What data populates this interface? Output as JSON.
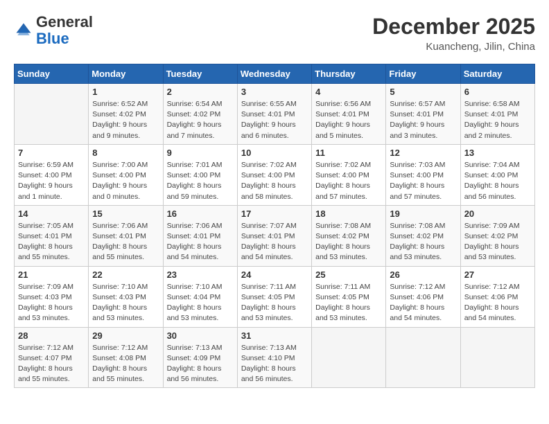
{
  "header": {
    "logo_general": "General",
    "logo_blue": "Blue",
    "month_year": "December 2025",
    "location": "Kuancheng, Jilin, China"
  },
  "weekdays": [
    "Sunday",
    "Monday",
    "Tuesday",
    "Wednesday",
    "Thursday",
    "Friday",
    "Saturday"
  ],
  "weeks": [
    [
      {
        "day": "",
        "detail": ""
      },
      {
        "day": "1",
        "detail": "Sunrise: 6:52 AM\nSunset: 4:02 PM\nDaylight: 9 hours\nand 9 minutes."
      },
      {
        "day": "2",
        "detail": "Sunrise: 6:54 AM\nSunset: 4:02 PM\nDaylight: 9 hours\nand 7 minutes."
      },
      {
        "day": "3",
        "detail": "Sunrise: 6:55 AM\nSunset: 4:01 PM\nDaylight: 9 hours\nand 6 minutes."
      },
      {
        "day": "4",
        "detail": "Sunrise: 6:56 AM\nSunset: 4:01 PM\nDaylight: 9 hours\nand 5 minutes."
      },
      {
        "day": "5",
        "detail": "Sunrise: 6:57 AM\nSunset: 4:01 PM\nDaylight: 9 hours\nand 3 minutes."
      },
      {
        "day": "6",
        "detail": "Sunrise: 6:58 AM\nSunset: 4:01 PM\nDaylight: 9 hours\nand 2 minutes."
      }
    ],
    [
      {
        "day": "7",
        "detail": "Sunrise: 6:59 AM\nSunset: 4:00 PM\nDaylight: 9 hours\nand 1 minute."
      },
      {
        "day": "8",
        "detail": "Sunrise: 7:00 AM\nSunset: 4:00 PM\nDaylight: 9 hours\nand 0 minutes."
      },
      {
        "day": "9",
        "detail": "Sunrise: 7:01 AM\nSunset: 4:00 PM\nDaylight: 8 hours\nand 59 minutes."
      },
      {
        "day": "10",
        "detail": "Sunrise: 7:02 AM\nSunset: 4:00 PM\nDaylight: 8 hours\nand 58 minutes."
      },
      {
        "day": "11",
        "detail": "Sunrise: 7:02 AM\nSunset: 4:00 PM\nDaylight: 8 hours\nand 57 minutes."
      },
      {
        "day": "12",
        "detail": "Sunrise: 7:03 AM\nSunset: 4:00 PM\nDaylight: 8 hours\nand 57 minutes."
      },
      {
        "day": "13",
        "detail": "Sunrise: 7:04 AM\nSunset: 4:00 PM\nDaylight: 8 hours\nand 56 minutes."
      }
    ],
    [
      {
        "day": "14",
        "detail": "Sunrise: 7:05 AM\nSunset: 4:01 PM\nDaylight: 8 hours\nand 55 minutes."
      },
      {
        "day": "15",
        "detail": "Sunrise: 7:06 AM\nSunset: 4:01 PM\nDaylight: 8 hours\nand 55 minutes."
      },
      {
        "day": "16",
        "detail": "Sunrise: 7:06 AM\nSunset: 4:01 PM\nDaylight: 8 hours\nand 54 minutes."
      },
      {
        "day": "17",
        "detail": "Sunrise: 7:07 AM\nSunset: 4:01 PM\nDaylight: 8 hours\nand 54 minutes."
      },
      {
        "day": "18",
        "detail": "Sunrise: 7:08 AM\nSunset: 4:02 PM\nDaylight: 8 hours\nand 53 minutes."
      },
      {
        "day": "19",
        "detail": "Sunrise: 7:08 AM\nSunset: 4:02 PM\nDaylight: 8 hours\nand 53 minutes."
      },
      {
        "day": "20",
        "detail": "Sunrise: 7:09 AM\nSunset: 4:02 PM\nDaylight: 8 hours\nand 53 minutes."
      }
    ],
    [
      {
        "day": "21",
        "detail": "Sunrise: 7:09 AM\nSunset: 4:03 PM\nDaylight: 8 hours\nand 53 minutes."
      },
      {
        "day": "22",
        "detail": "Sunrise: 7:10 AM\nSunset: 4:03 PM\nDaylight: 8 hours\nand 53 minutes."
      },
      {
        "day": "23",
        "detail": "Sunrise: 7:10 AM\nSunset: 4:04 PM\nDaylight: 8 hours\nand 53 minutes."
      },
      {
        "day": "24",
        "detail": "Sunrise: 7:11 AM\nSunset: 4:05 PM\nDaylight: 8 hours\nand 53 minutes."
      },
      {
        "day": "25",
        "detail": "Sunrise: 7:11 AM\nSunset: 4:05 PM\nDaylight: 8 hours\nand 53 minutes."
      },
      {
        "day": "26",
        "detail": "Sunrise: 7:12 AM\nSunset: 4:06 PM\nDaylight: 8 hours\nand 54 minutes."
      },
      {
        "day": "27",
        "detail": "Sunrise: 7:12 AM\nSunset: 4:06 PM\nDaylight: 8 hours\nand 54 minutes."
      }
    ],
    [
      {
        "day": "28",
        "detail": "Sunrise: 7:12 AM\nSunset: 4:07 PM\nDaylight: 8 hours\nand 55 minutes."
      },
      {
        "day": "29",
        "detail": "Sunrise: 7:12 AM\nSunset: 4:08 PM\nDaylight: 8 hours\nand 55 minutes."
      },
      {
        "day": "30",
        "detail": "Sunrise: 7:13 AM\nSunset: 4:09 PM\nDaylight: 8 hours\nand 56 minutes."
      },
      {
        "day": "31",
        "detail": "Sunrise: 7:13 AM\nSunset: 4:10 PM\nDaylight: 8 hours\nand 56 minutes."
      },
      {
        "day": "",
        "detail": ""
      },
      {
        "day": "",
        "detail": ""
      },
      {
        "day": "",
        "detail": ""
      }
    ]
  ]
}
